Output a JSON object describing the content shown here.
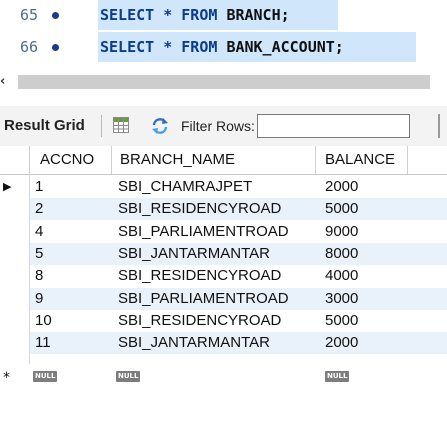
{
  "editor": {
    "lines": [
      {
        "number": "65",
        "keyword_before": "SELECT * FROM ",
        "table": "BRANCH;"
      },
      {
        "number": "66",
        "keyword_before": "SELECT * FROM ",
        "table": "BANK_ACCOUNT;"
      }
    ]
  },
  "scrollbar": {
    "left_arrow": "‹"
  },
  "toolbar": {
    "result_grid_label": "Result Grid",
    "filter_rows_label": "Filter Rows:",
    "filter_value": ""
  },
  "grid": {
    "columns": [
      "ACCNO",
      "BRANCH_NAME",
      "BALANCE"
    ],
    "current_row_marker": "▶",
    "new_row_marker": "*",
    "null_label": "NULL",
    "rows": [
      {
        "accno": "1",
        "branch_name": "SBI_CHAMRAJPET",
        "balance": "2000"
      },
      {
        "accno": "2",
        "branch_name": "SBI_RESIDENCYROAD",
        "balance": "5000"
      },
      {
        "accno": "4",
        "branch_name": "SBI_PARLIAMENTROAD",
        "balance": "9000"
      },
      {
        "accno": "5",
        "branch_name": "SBI_JANTARMANTAR",
        "balance": "8000"
      },
      {
        "accno": "8",
        "branch_name": "SBI_RESIDENCYROAD",
        "balance": "4000"
      },
      {
        "accno": "9",
        "branch_name": "SBI_PARLIAMENTROAD",
        "balance": "3000"
      },
      {
        "accno": "10",
        "branch_name": "SBI_RESIDENCYROAD",
        "balance": "5000"
      },
      {
        "accno": "11",
        "branch_name": "SBI_JANTARMANTAR",
        "balance": "2000"
      }
    ]
  },
  "colors": {
    "selection": "#cfe6fb",
    "keyword": "#0b3d8c",
    "alt_row": "#e9f1fb",
    "null_badge": "#7d7d7d"
  }
}
